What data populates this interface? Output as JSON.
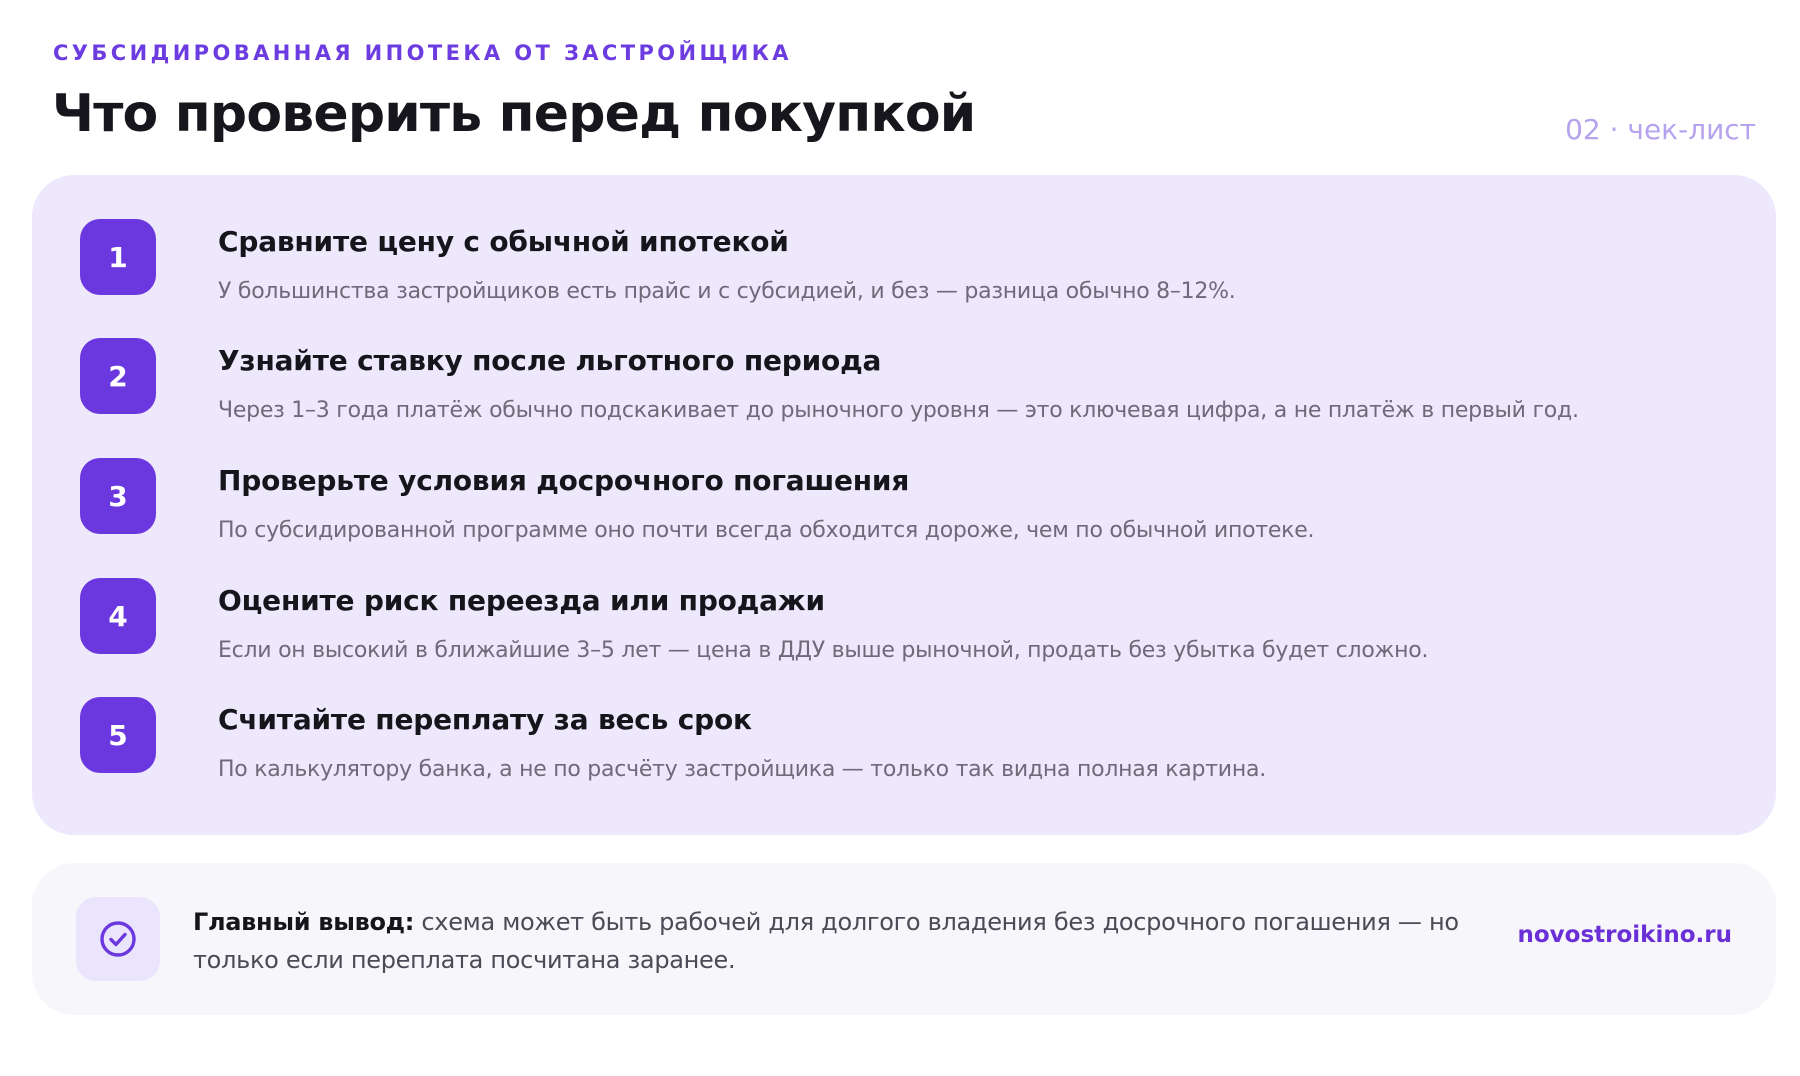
{
  "header": {
    "eyebrow": "СУБСИДИРОВАННАЯ ИПОТЕКА ОТ ЗАСТРОЙЩИКА",
    "title": "Что проверить перед покупкой",
    "meta": "02 · чек-лист"
  },
  "steps": [
    {
      "number": "1",
      "title": "Сравните цену с обычной ипотекой",
      "description": "У большинства застройщиков есть прайс и с субсидией, и без — разница обычно 8–12%."
    },
    {
      "number": "2",
      "title": "Узнайте ставку после льготного периода",
      "description": "Через 1–3 года платёж обычно подскакивает до рыночного уровня — это ключевая цифра, а не платёж в первый год."
    },
    {
      "number": "3",
      "title": "Проверьте условия досрочного погашения",
      "description": "По субсидированной программе оно почти всегда обходится дороже, чем по обычной ипотеке."
    },
    {
      "number": "4",
      "title": "Оцените риск переезда или продажи",
      "description": "Если он высокий в ближайшие 3–5 лет — цена в ДДУ выше рыночной, продать без убытка будет сложно."
    },
    {
      "number": "5",
      "title": "Считайте переплату за весь срок",
      "description": "По калькулятору банка, а не по расчёту застройщика — только так видна полная картина."
    }
  ],
  "conclusion": {
    "icon": "check-circle-icon",
    "label": "Главный вывод:",
    "text": " схема может быть рабочей для долгого владения без досрочного погашения — но только если переплата посчитана заранее."
  },
  "footer": {
    "site": "novostroikino.ru"
  },
  "colors": {
    "accent": "#6a38de",
    "card_background": "#eee8fd",
    "conclusion_background": "#f7f6fa",
    "meta": "#b6a3ee"
  }
}
